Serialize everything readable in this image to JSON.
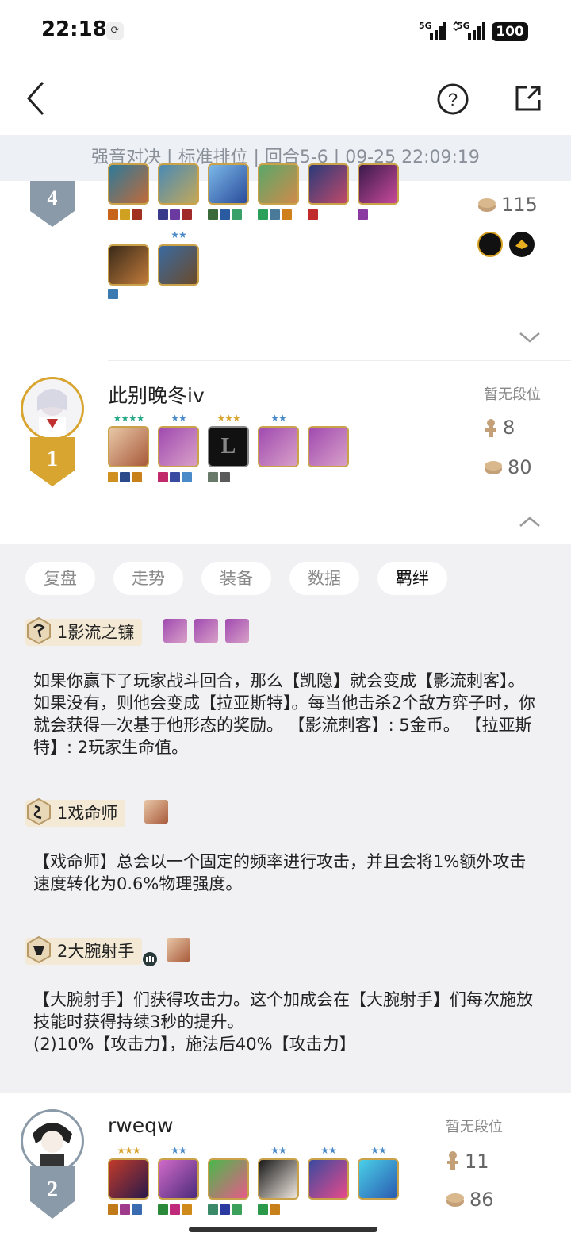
{
  "status": {
    "time": "22:18",
    "network1": "5G",
    "network2": "5G",
    "battery": "100"
  },
  "header": {
    "back_icon": "chevron-left-icon",
    "help_icon": "help-circle-icon",
    "share_icon": "share-external-icon"
  },
  "match_info": "强音对决 | 标准排位 | 回合5-6 | 09-25 22:09:19",
  "player_top": {
    "rank": "4",
    "coins": "115"
  },
  "player1": {
    "rank": "1",
    "name": "此别晚冬iv",
    "tier": "暂无段位",
    "level": "8",
    "coins": "80"
  },
  "player2": {
    "rank": "2",
    "name": "rweqw",
    "tier": "暂无段位",
    "level": "11",
    "coins": "86"
  },
  "tabs": [
    {
      "label": "复盘"
    },
    {
      "label": "走势"
    },
    {
      "label": "装备"
    },
    {
      "label": "数据"
    },
    {
      "label": "羁绊"
    }
  ],
  "traits": [
    {
      "title": "1影流之镰",
      "desc": "如果你赢下了玩家战斗回合，那么【凯隐】就会变成【影流刺客】。如果没有，则他会变成【拉亚斯特】。每当他击杀2个敌方弈子时，你就会获得一次基于他形态的奖励。 【影流刺客】: 5金币。 【拉亚斯特】: 2玩家生命值。"
    },
    {
      "title": "1戏命师",
      "desc": "【戏命师】总会以一个固定的频率进行攻击，并且会将1%额外攻击速度转化为0.6%物理强度。"
    },
    {
      "title": "2大腕射手",
      "desc": "【大腕射手】们获得攻击力。这个加成会在【大腕射手】们每次施放技能时获得持续3秒的提升。\n(2)10%【攻击力】，施法后40%【攻击力】"
    }
  ],
  "colors": {
    "gold": "#d9a531",
    "silver": "#8b9aa8",
    "panel_bg": "#f1f1f3",
    "meta_bg": "#edf0f4",
    "trait_tag_bg": "#f3e9d4"
  }
}
